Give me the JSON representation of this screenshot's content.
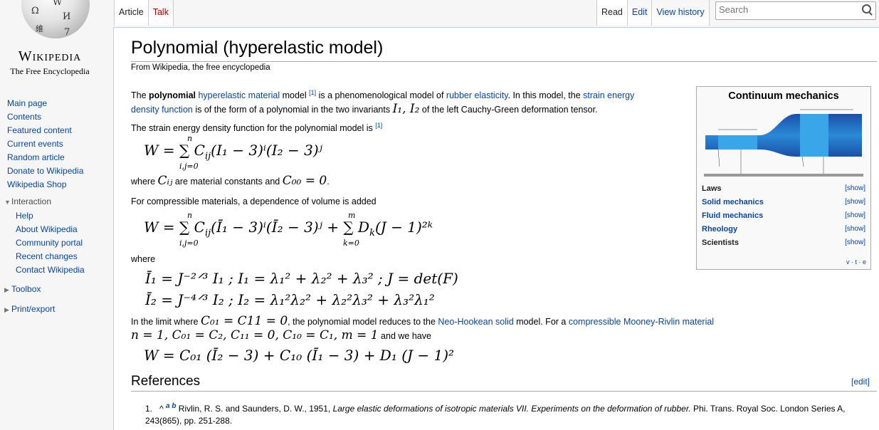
{
  "logo": {
    "wordmark": "Wikipedia",
    "tagline": "The Free Encyclopedia",
    "globe_glyphs": [
      "Ω",
      "И",
      "維",
      "W",
      "7"
    ]
  },
  "nav": {
    "items": [
      "Main page",
      "Contents",
      "Featured content",
      "Current events",
      "Random article",
      "Donate to Wikipedia",
      "Wikipedia Shop"
    ],
    "interaction": {
      "heading": "Interaction",
      "items": [
        "Help",
        "About Wikipedia",
        "Community portal",
        "Recent changes",
        "Contact Wikipedia"
      ]
    },
    "toolbox": "Toolbox",
    "print": "Print/export"
  },
  "tabs": {
    "article": "Article",
    "talk": "Talk",
    "read": "Read",
    "edit": "Edit",
    "history": "View history"
  },
  "search": {
    "placeholder": "Search"
  },
  "article": {
    "title": "Polynomial (hyperelastic model)",
    "from": "From Wikipedia, the free encyclopedia",
    "p1": {
      "a": "The ",
      "b": "polynomial",
      "c": " ",
      "link1": "hyperelastic material",
      "d": " model ",
      "ref": "[1]",
      "e": " is a phenomenological model of ",
      "link2": "rubber elasticity",
      "f": ". In this model, the ",
      "link3a": "strain energy",
      "link3b": "density function",
      "g": " is of the form of a polynomial in the two invariants ",
      "m1": "I₁, I₂",
      "h": " of the left Cauchy-Green deformation tensor."
    },
    "p2": {
      "text": "The strain energy density function for the polynomial model is ",
      "ref": "[1]"
    },
    "eq1": {
      "main": "W = ∑ C",
      "sub": "ij",
      "rest": "(I₁ − 3)ⁱ(I₂ − 3)ʲ",
      "top": "n",
      "bottom": "i,j=0"
    },
    "p3": {
      "a": "where ",
      "m1": "Cᵢⱼ",
      "b": " are material constants and ",
      "m2": "C₀₀ = 0",
      "c": "."
    },
    "p4": "For compressible materials, a dependence of volume is added",
    "eq2": {
      "main": "W = ∑ C",
      "sub": "ij",
      "rest": "(Ī₁ − 3)ⁱ(Ī₂ − 3)ʲ + ∑ D",
      "sub2": "k",
      "rest2": "(J − 1)²ᵏ",
      "top1": "n",
      "bottom1": "i,j=0",
      "top2": "m",
      "bottom2": "k=0"
    },
    "p5": "where",
    "eq3": "Ī₁ = J⁻²ᐟ³ I₁ ;   I₁ = λ₁² + λ₂² + λ₃² ;   J = det(F)",
    "eq4": "Ī₂ = J⁻⁴ᐟ³ I₂ ;   I₂ = λ₁²λ₂² + λ₂²λ₃² + λ₃²λ₁²",
    "p6": {
      "a": "In the limit where ",
      "m1": "C₀₁ = C11 = 0",
      "b": ", the polynomial model reduces to the ",
      "link1": "Neo-Hookean solid",
      "c": " model. For a ",
      "link2": "compressible Mooney-Rivlin material"
    },
    "p7": {
      "m1": "n = 1, C₀₁ = C₂, C₁₁ = 0, C₁₀ = C₁, m = 1",
      "b": " and we have"
    },
    "eq5": "W = C₀₁ (Ī₂ − 3) + C₁₀ (Ī₁ − 3) + D₁ (J − 1)²",
    "references_heading": "References",
    "edit_link": "[edit]",
    "ref1": {
      "num": "1.",
      "caret": "^",
      "a": "a",
      "b": "b",
      "text1": " Rivlin, R. S. and Saunders, D. W., 1951, ",
      "italic": "Large elastic deformations of isotropic materials VII. Experiments on the deformation of rubber.",
      "text2": " Phi. Trans. Royal Soc. London Series A,",
      "text3": "243(865), pp. 251-288."
    }
  },
  "infobox": {
    "title": "Continuum mechanics",
    "rows": [
      {
        "label": "Laws",
        "show": "[show]",
        "link": false
      },
      {
        "label": "Solid mechanics",
        "show": "[show]",
        "link": true
      },
      {
        "label": "Fluid mechanics",
        "show": "[show]",
        "link": true
      },
      {
        "label": "Rheology",
        "show": "[show]",
        "link": true
      },
      {
        "label": "Scientists",
        "show": "[show]",
        "link": false
      }
    ],
    "vte": "v · t · e"
  }
}
